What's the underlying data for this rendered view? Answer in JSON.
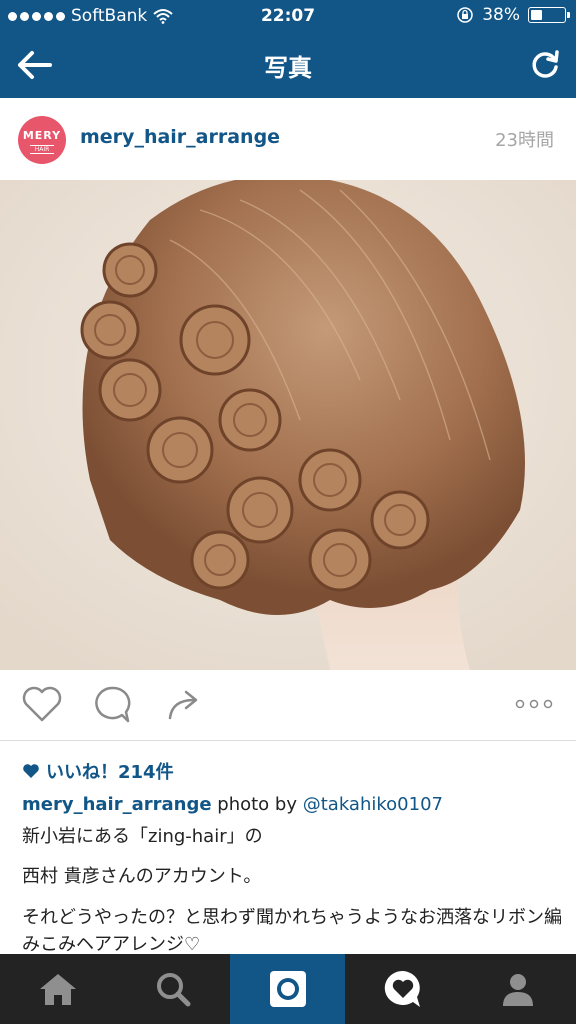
{
  "status_bar": {
    "carrier": "SoftBank",
    "time": "22:07",
    "battery_percent": "38%",
    "battery_level": 0.38
  },
  "nav": {
    "title": "写真",
    "back_icon": "arrow-left-icon",
    "refresh_icon": "refresh-icon"
  },
  "post": {
    "avatar": {
      "line1": "MERY",
      "line2": "HAIR",
      "color": "#e8566b"
    },
    "username": "mery_hair_arrange",
    "time_ago": "23時間",
    "likes_text": "いいね！214件",
    "caption": {
      "username": "mery_hair_arrange",
      "photo_by": "photo by",
      "credit": "@takahiko0107",
      "line1": "新小岩にある「zing-hair」の",
      "line2": "西村 貴彦さんのアカウント。",
      "line3": "それどうやったの？と思わず聞かれちゃうようなお洒落なリボン編みこみヘアアレンジ♡"
    }
  },
  "tabs": [
    {
      "name": "home",
      "icon": "home-icon"
    },
    {
      "name": "search",
      "icon": "search-icon"
    },
    {
      "name": "camera",
      "icon": "camera-icon",
      "active": true
    },
    {
      "name": "activity",
      "icon": "heart-bubble-icon"
    },
    {
      "name": "profile",
      "icon": "person-icon"
    }
  ],
  "colors": {
    "brand": "#125688",
    "tabbar": "#232323",
    "muted": "#a6a6a6"
  }
}
